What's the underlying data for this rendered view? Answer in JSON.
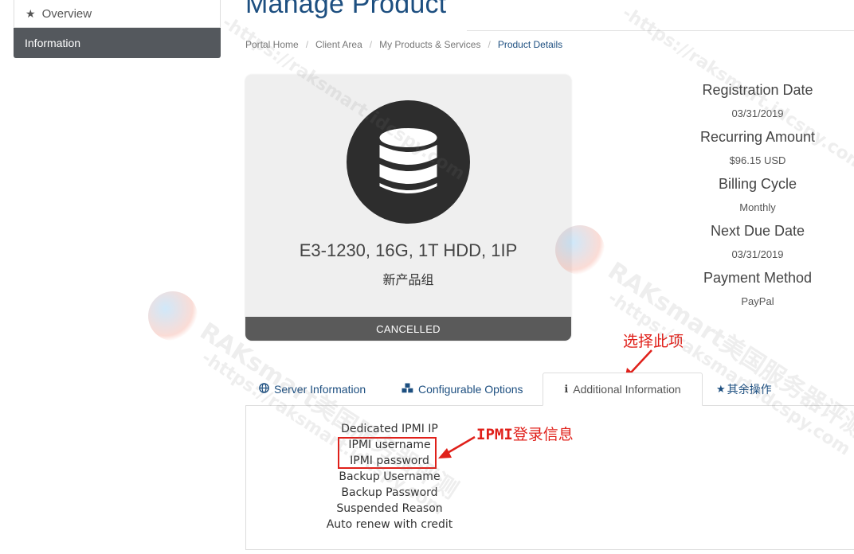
{
  "sidebar": {
    "items": [
      {
        "label": "Overview",
        "icon": "star-icon"
      },
      {
        "label": "Information"
      }
    ]
  },
  "header": {
    "title": "Manage Product",
    "breadcrumb": [
      "Portal Home",
      "Client Area",
      "My Products & Services",
      "Product Details"
    ]
  },
  "product": {
    "icon": "database-icon",
    "name": "E3-1230, 16G, 1T HDD, 1IP",
    "group": "新产品组",
    "status": "CANCELLED"
  },
  "billing": [
    {
      "label": "Registration Date",
      "value": "03/31/2019"
    },
    {
      "label": "Recurring Amount",
      "value": "$96.15 USD"
    },
    {
      "label": "Billing Cycle",
      "value": "Monthly"
    },
    {
      "label": "Next Due Date",
      "value": "03/31/2019"
    },
    {
      "label": "Payment Method",
      "value": "PayPal"
    }
  ],
  "tabs": [
    {
      "label": "Server Information",
      "icon": "globe-icon"
    },
    {
      "label": "Configurable Options",
      "icon": "cubes-icon"
    },
    {
      "label": "Additional Information",
      "icon": "info-icon"
    },
    {
      "label": "其余操作",
      "icon": "star-icon"
    }
  ],
  "additional_fields": [
    "Dedicated IPMI IP",
    "IPMI username",
    "IPMI password",
    "Backup Username",
    "Backup Password",
    "Suspended Reason",
    "Auto renew with credit"
  ],
  "annotations": {
    "select_tab": "选择此项",
    "ipmi_prefix": "IPMI",
    "ipmi_suffix": "登录信息",
    "color": "#e0201a"
  },
  "watermark": {
    "text1": "RAKsmart美国服务器评测",
    "text2": "-https://raksmart.idcspy.com"
  },
  "colors": {
    "accent": "#1d4f80",
    "sidebar_active": "#54585d",
    "status_bar": "#5a5a5a"
  }
}
